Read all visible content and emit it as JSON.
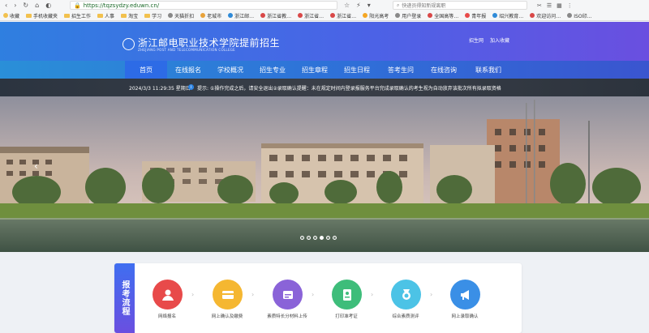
{
  "browser": {
    "url": "https://tqzsydzy.eduwn.cn/",
    "search_placeholder": "快递员得知新规离职"
  },
  "bookmarks": [
    "收藏",
    "手机收藏夹",
    "招生工作",
    "人事",
    "淘宝",
    "学习",
    "天猫折扣",
    "老城市",
    "浙江邮…",
    "浙江省教…",
    "浙江省…",
    "浙江省…",
    "阳光高考",
    "用户登录",
    "全国高等…",
    "青年报",
    "绍兴教育…",
    "欢迎访问…",
    "ISO印…"
  ],
  "header": {
    "school_name": "浙江邮电职业技术学院",
    "suffix": "提前招生",
    "english_name": "ZHEJIANG POST AND TELECOMMUNICATION COLLEGE",
    "links": [
      "招生网",
      "加入收藏"
    ]
  },
  "nav": {
    "items": [
      "首页",
      "在线报名",
      "学校概况",
      "招生专业",
      "招生章程",
      "招生日程",
      "答考生问",
      "在线咨询",
      "联系我们"
    ]
  },
  "notice": {
    "datetime": "2024/3/3 11:29:35 星期日",
    "label": "提示:",
    "text": "①操作完成之后，请安全退出②录取确认提醒：未在规定时间内登录报服务平台完成录取确认的考生视为自动放弃该批次所有拟录取资格"
  },
  "banner": {
    "slides_count": 6,
    "active_slide": 4
  },
  "steps": {
    "title": "报考流程",
    "items": [
      {
        "label": "网络报名",
        "color": "#e84a4a"
      },
      {
        "label": "网上确认及缴费",
        "color": "#f5b731"
      },
      {
        "label": "素质特长分材料上传",
        "color": "#8a63d8"
      },
      {
        "label": "打印准考证",
        "color": "#3ebd7a"
      },
      {
        "label": "综合素质测评",
        "color": "#4cc3e6"
      },
      {
        "label": "网上录取确认",
        "color": "#3a8fe6"
      }
    ]
  }
}
